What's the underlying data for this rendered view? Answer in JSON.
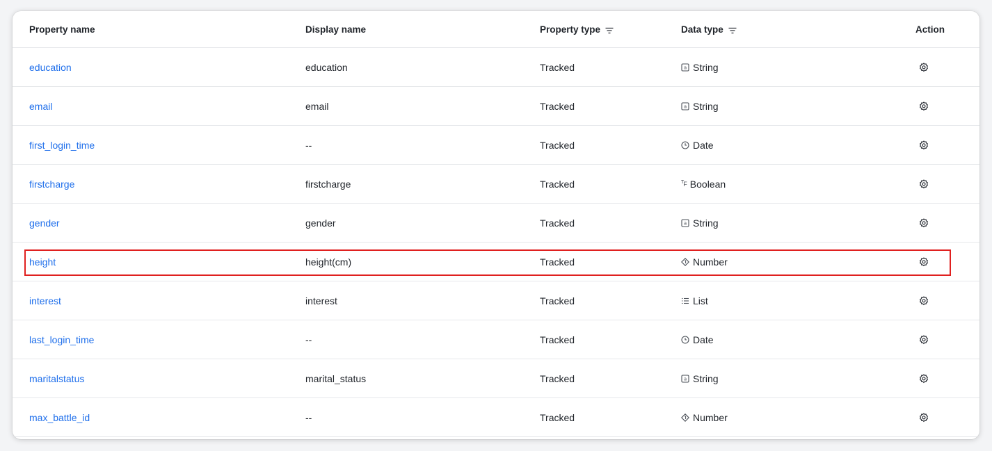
{
  "columns": {
    "property_name": "Property name",
    "display_name": "Display name",
    "property_type": "Property type",
    "data_type": "Data type",
    "action": "Action"
  },
  "rows": [
    {
      "property_name": "education",
      "display_name": "education",
      "property_type": "Tracked",
      "data_type": "String",
      "data_type_icon": "string-icon"
    },
    {
      "property_name": "email",
      "display_name": "email",
      "property_type": "Tracked",
      "data_type": "String",
      "data_type_icon": "string-icon"
    },
    {
      "property_name": "first_login_time",
      "display_name": "--",
      "property_type": "Tracked",
      "data_type": "Date",
      "data_type_icon": "clock-icon"
    },
    {
      "property_name": "firstcharge",
      "display_name": "firstcharge",
      "property_type": "Tracked",
      "data_type": "Boolean",
      "data_type_icon": "boolean-icon"
    },
    {
      "property_name": "gender",
      "display_name": "gender",
      "property_type": "Tracked",
      "data_type": "String",
      "data_type_icon": "string-icon"
    },
    {
      "property_name": "height",
      "display_name": "height(cm)",
      "property_type": "Tracked",
      "data_type": "Number",
      "data_type_icon": "number-icon",
      "highlighted": true
    },
    {
      "property_name": "interest",
      "display_name": "interest",
      "property_type": "Tracked",
      "data_type": "List",
      "data_type_icon": "list-icon"
    },
    {
      "property_name": "last_login_time",
      "display_name": "--",
      "property_type": "Tracked",
      "data_type": "Date",
      "data_type_icon": "clock-icon"
    },
    {
      "property_name": "maritalstatus",
      "display_name": "marital_status",
      "property_type": "Tracked",
      "data_type": "String",
      "data_type_icon": "string-icon"
    },
    {
      "property_name": "max_battle_id",
      "display_name": "--",
      "property_type": "Tracked",
      "data_type": "Number",
      "data_type_icon": "number-icon"
    }
  ],
  "colors": {
    "link": "#1f6feb",
    "highlight_border": "#e0201f",
    "text": "#1f2329"
  }
}
